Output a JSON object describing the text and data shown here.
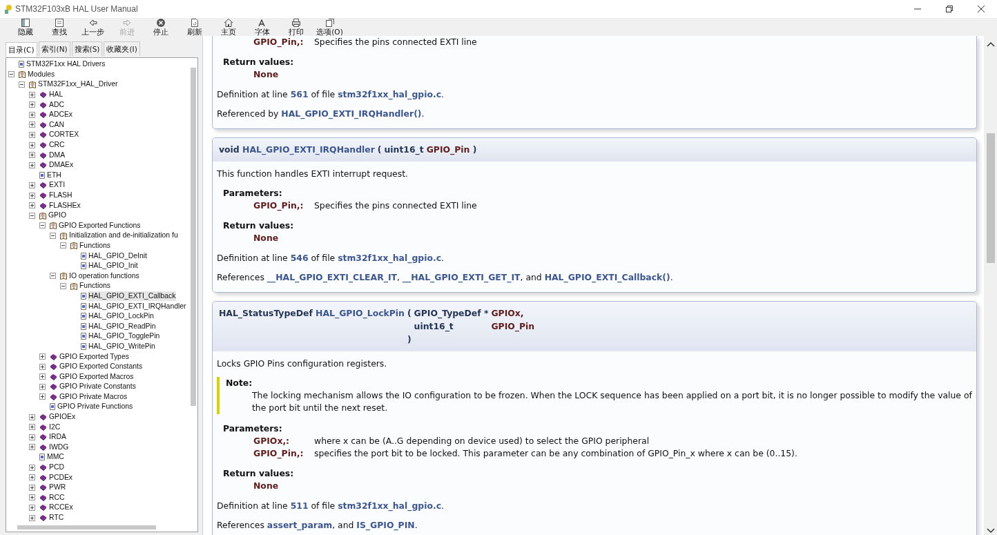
{
  "window": {
    "title": "STM32F103xB HAL User Manual"
  },
  "toolbar": [
    {
      "label": "隐藏",
      "kind": "hide",
      "disabled": false
    },
    {
      "label": "查找",
      "kind": "find",
      "disabled": false
    },
    {
      "label": "上一步",
      "kind": "back",
      "disabled": false
    },
    {
      "label": "前进",
      "kind": "forward",
      "disabled": true
    },
    {
      "label": "停止",
      "kind": "stop",
      "disabled": false
    },
    {
      "label": "刷新",
      "kind": "refresh",
      "disabled": false
    },
    {
      "label": "主页",
      "kind": "home",
      "disabled": false
    },
    {
      "label": "字体",
      "kind": "font",
      "disabled": false
    },
    {
      "label": "打印",
      "kind": "print",
      "disabled": false
    },
    {
      "label": "选项(O)",
      "kind": "options",
      "disabled": false
    }
  ],
  "tabs": [
    {
      "label": "目录(C)",
      "selected": true
    },
    {
      "label": "索引(N)",
      "selected": false
    },
    {
      "label": "搜索(S)",
      "selected": false
    },
    {
      "label": "收藏夹(I)",
      "selected": false
    }
  ],
  "tree": [
    {
      "label": "STM32F1xx HAL Drivers",
      "kind": "page",
      "selected": false
    },
    {
      "label": "Modules",
      "kind": "open",
      "expanded": true,
      "selected": false,
      "children": [
        {
          "label": "STM32F1xx_HAL_Driver",
          "kind": "open",
          "expanded": true,
          "selected": false,
          "children": [
            {
              "label": "HAL",
              "kind": "book",
              "expanded": false,
              "selected": false
            },
            {
              "label": "ADC",
              "kind": "book",
              "expanded": false,
              "selected": false
            },
            {
              "label": "ADCEx",
              "kind": "book",
              "expanded": false,
              "selected": false
            },
            {
              "label": "CAN",
              "kind": "book",
              "expanded": false,
              "selected": false
            },
            {
              "label": "CORTEX",
              "kind": "book",
              "expanded": false,
              "selected": false
            },
            {
              "label": "CRC",
              "kind": "book",
              "expanded": false,
              "selected": false
            },
            {
              "label": "DMA",
              "kind": "book",
              "expanded": false,
              "selected": false
            },
            {
              "label": "DMAEx",
              "kind": "book",
              "expanded": false,
              "selected": false
            },
            {
              "label": "ETH",
              "kind": "page",
              "selected": false
            },
            {
              "label": "EXTI",
              "kind": "book",
              "expanded": false,
              "selected": false
            },
            {
              "label": "FLASH",
              "kind": "book",
              "expanded": false,
              "selected": false
            },
            {
              "label": "FLASHEx",
              "kind": "book",
              "expanded": false,
              "selected": false
            },
            {
              "label": "GPIO",
              "kind": "open",
              "expanded": true,
              "selected": false,
              "children": [
                {
                  "label": "GPIO Exported Functions",
                  "kind": "open",
                  "expanded": true,
                  "selected": false,
                  "children": [
                    {
                      "label": "Initialization and de-initialization fu",
                      "kind": "open",
                      "expanded": true,
                      "selected": false,
                      "children": [
                        {
                          "label": "Functions",
                          "kind": "open",
                          "expanded": true,
                          "selected": false,
                          "children": [
                            {
                              "label": "HAL_GPIO_DeInit",
                              "kind": "page",
                              "selected": false
                            },
                            {
                              "label": "HAL_GPIO_Init",
                              "kind": "page",
                              "selected": false
                            }
                          ]
                        }
                      ]
                    },
                    {
                      "label": "IO operation functions",
                      "kind": "open",
                      "expanded": true,
                      "selected": false,
                      "children": [
                        {
                          "label": "Functions",
                          "kind": "open",
                          "expanded": true,
                          "selected": false,
                          "children": [
                            {
                              "label": "HAL_GPIO_EXTI_Callback",
                              "kind": "page",
                              "selected": true
                            },
                            {
                              "label": "HAL_GPIO_EXTI_IRQHandler",
                              "kind": "page",
                              "selected": false
                            },
                            {
                              "label": "HAL_GPIO_LockPin",
                              "kind": "page",
                              "selected": false
                            },
                            {
                              "label": "HAL_GPIO_ReadPin",
                              "kind": "page",
                              "selected": false
                            },
                            {
                              "label": "HAL_GPIO_TogglePin",
                              "kind": "page",
                              "selected": false
                            },
                            {
                              "label": "HAL_GPIO_WritePin",
                              "kind": "page",
                              "selected": false
                            }
                          ]
                        }
                      ]
                    }
                  ]
                },
                {
                  "label": "GPIO Exported Types",
                  "kind": "book",
                  "expanded": false,
                  "selected": false
                },
                {
                  "label": "GPIO Exported Constants",
                  "kind": "book",
                  "expanded": false,
                  "selected": false
                },
                {
                  "label": "GPIO Exported Macros",
                  "kind": "book",
                  "expanded": false,
                  "selected": false
                },
                {
                  "label": "GPIO Private Constants",
                  "kind": "book",
                  "expanded": false,
                  "selected": false
                },
                {
                  "label": "GPIO Private Macros",
                  "kind": "book",
                  "expanded": false,
                  "selected": false
                },
                {
                  "label": "GPIO Private Functions",
                  "kind": "page",
                  "selected": false
                }
              ]
            },
            {
              "label": "GPIOEx",
              "kind": "book",
              "expanded": false,
              "selected": false
            },
            {
              "label": "I2C",
              "kind": "book",
              "expanded": false,
              "selected": false
            },
            {
              "label": "IRDA",
              "kind": "book",
              "expanded": false,
              "selected": false
            },
            {
              "label": "IWDG",
              "kind": "book",
              "expanded": false,
              "selected": false
            },
            {
              "label": "MMC",
              "kind": "page",
              "selected": false
            },
            {
              "label": "PCD",
              "kind": "book",
              "expanded": false,
              "selected": false
            },
            {
              "label": "PCDEx",
              "kind": "book",
              "expanded": false,
              "selected": false
            },
            {
              "label": "PWR",
              "kind": "book",
              "expanded": false,
              "selected": false
            },
            {
              "label": "RCC",
              "kind": "book",
              "expanded": false,
              "selected": false
            },
            {
              "label": "RCCEx",
              "kind": "book",
              "expanded": false,
              "selected": false
            },
            {
              "label": "RTC",
              "kind": "book",
              "expanded": false,
              "selected": false
            }
          ]
        }
      ]
    }
  ],
  "blocks": [
    {
      "items": [
        {
          "kind": "params",
          "entries": [
            {
              "name": "GPIO_Pin,:",
              "desc": "Specifies the pins connected EXTI line"
            }
          ]
        },
        {
          "kind": "returns",
          "title": "Return values:",
          "values": [
            "None"
          ]
        },
        {
          "kind": "para",
          "runs": [
            {
              "text": "Definition at line ",
              "link": false
            },
            {
              "text": "561",
              "link": true
            },
            {
              "text": " of file ",
              "link": false
            },
            {
              "text": "stm32f1xx_hal_gpio.c",
              "link": true
            },
            {
              "text": ".",
              "link": false
            }
          ]
        },
        {
          "kind": "para",
          "runs": [
            {
              "text": "Referenced by ",
              "link": false
            },
            {
              "text": "HAL_GPIO_EXTI_IRQHandler()",
              "link": true
            },
            {
              "text": ".",
              "link": false
            }
          ]
        }
      ]
    },
    {
      "signature": {
        "prefix": "void",
        "name": "HAL_GPIO_EXTI_IRQHandler",
        "open": "(",
        "params": [
          {
            "type": "uint16_t",
            "name": "GPIO_Pin"
          }
        ],
        "close": ")"
      },
      "items": [
        {
          "kind": "para",
          "runs": [
            {
              "text": "This function handles EXTI interrupt request.",
              "link": false
            }
          ]
        },
        {
          "kind": "params",
          "title": "Parameters:",
          "entries": [
            {
              "name": "GPIO_Pin,:",
              "desc": "Specifies the pins connected EXTI line"
            }
          ]
        },
        {
          "kind": "returns",
          "title": "Return values:",
          "values": [
            "None"
          ]
        },
        {
          "kind": "para",
          "runs": [
            {
              "text": "Definition at line ",
              "link": false
            },
            {
              "text": "546",
              "link": true
            },
            {
              "text": " of file ",
              "link": false
            },
            {
              "text": "stm32f1xx_hal_gpio.c",
              "link": true
            },
            {
              "text": ".",
              "link": false
            }
          ]
        },
        {
          "kind": "para",
          "runs": [
            {
              "text": "References ",
              "link": false
            },
            {
              "text": "__HAL_GPIO_EXTI_CLEAR_IT",
              "link": true
            },
            {
              "text": ", ",
              "link": false
            },
            {
              "text": "__HAL_GPIO_EXTI_GET_IT",
              "link": true
            },
            {
              "text": ", and ",
              "link": false
            },
            {
              "text": "HAL_GPIO_EXTI_Callback()",
              "link": true
            },
            {
              "text": ".",
              "link": false
            }
          ]
        }
      ]
    },
    {
      "signature": {
        "prefix": "HAL_StatusTypeDef",
        "name": "HAL_GPIO_LockPin",
        "open": "(",
        "params": [
          {
            "type": "GPIO_TypeDef *",
            "name": "GPIOx,"
          },
          {
            "type": "uint16_t",
            "name": "GPIO_Pin"
          }
        ],
        "close": ")"
      },
      "items": [
        {
          "kind": "para",
          "runs": [
            {
              "text": "Locks GPIO Pins configuration registers.",
              "link": false
            }
          ]
        },
        {
          "kind": "note",
          "title": "Note:",
          "text": "The locking mechanism allows the IO configuration to be frozen. When the LOCK sequence has been applied on a port bit, it is no longer possible to modify the value of the port bit until the next reset."
        },
        {
          "kind": "params",
          "title": "Parameters:",
          "entries": [
            {
              "name": "GPIOx,:",
              "desc": "where x can be (A..G depending on device used) to select the GPIO peripheral"
            },
            {
              "name": "GPIO_Pin,:",
              "desc": "specifies the port bit to be locked. This parameter can be any combination of GPIO_Pin_x where x can be (0..15)."
            }
          ]
        },
        {
          "kind": "returns",
          "title": "Return values:",
          "values": [
            "None"
          ]
        },
        {
          "kind": "para",
          "runs": [
            {
              "text": "Definition at line ",
              "link": false
            },
            {
              "text": "511",
              "link": true
            },
            {
              "text": " of file ",
              "link": false
            },
            {
              "text": "stm32f1xx_hal_gpio.c",
              "link": true
            },
            {
              "text": ".",
              "link": false
            }
          ]
        },
        {
          "kind": "para",
          "runs": [
            {
              "text": "References ",
              "link": false
            },
            {
              "text": "assert_param",
              "link": true
            },
            {
              "text": ", and ",
              "link": false
            },
            {
              "text": "IS_GPIO_PIN",
              "link": true
            },
            {
              "text": ".",
              "link": false
            }
          ]
        }
      ]
    }
  ]
}
